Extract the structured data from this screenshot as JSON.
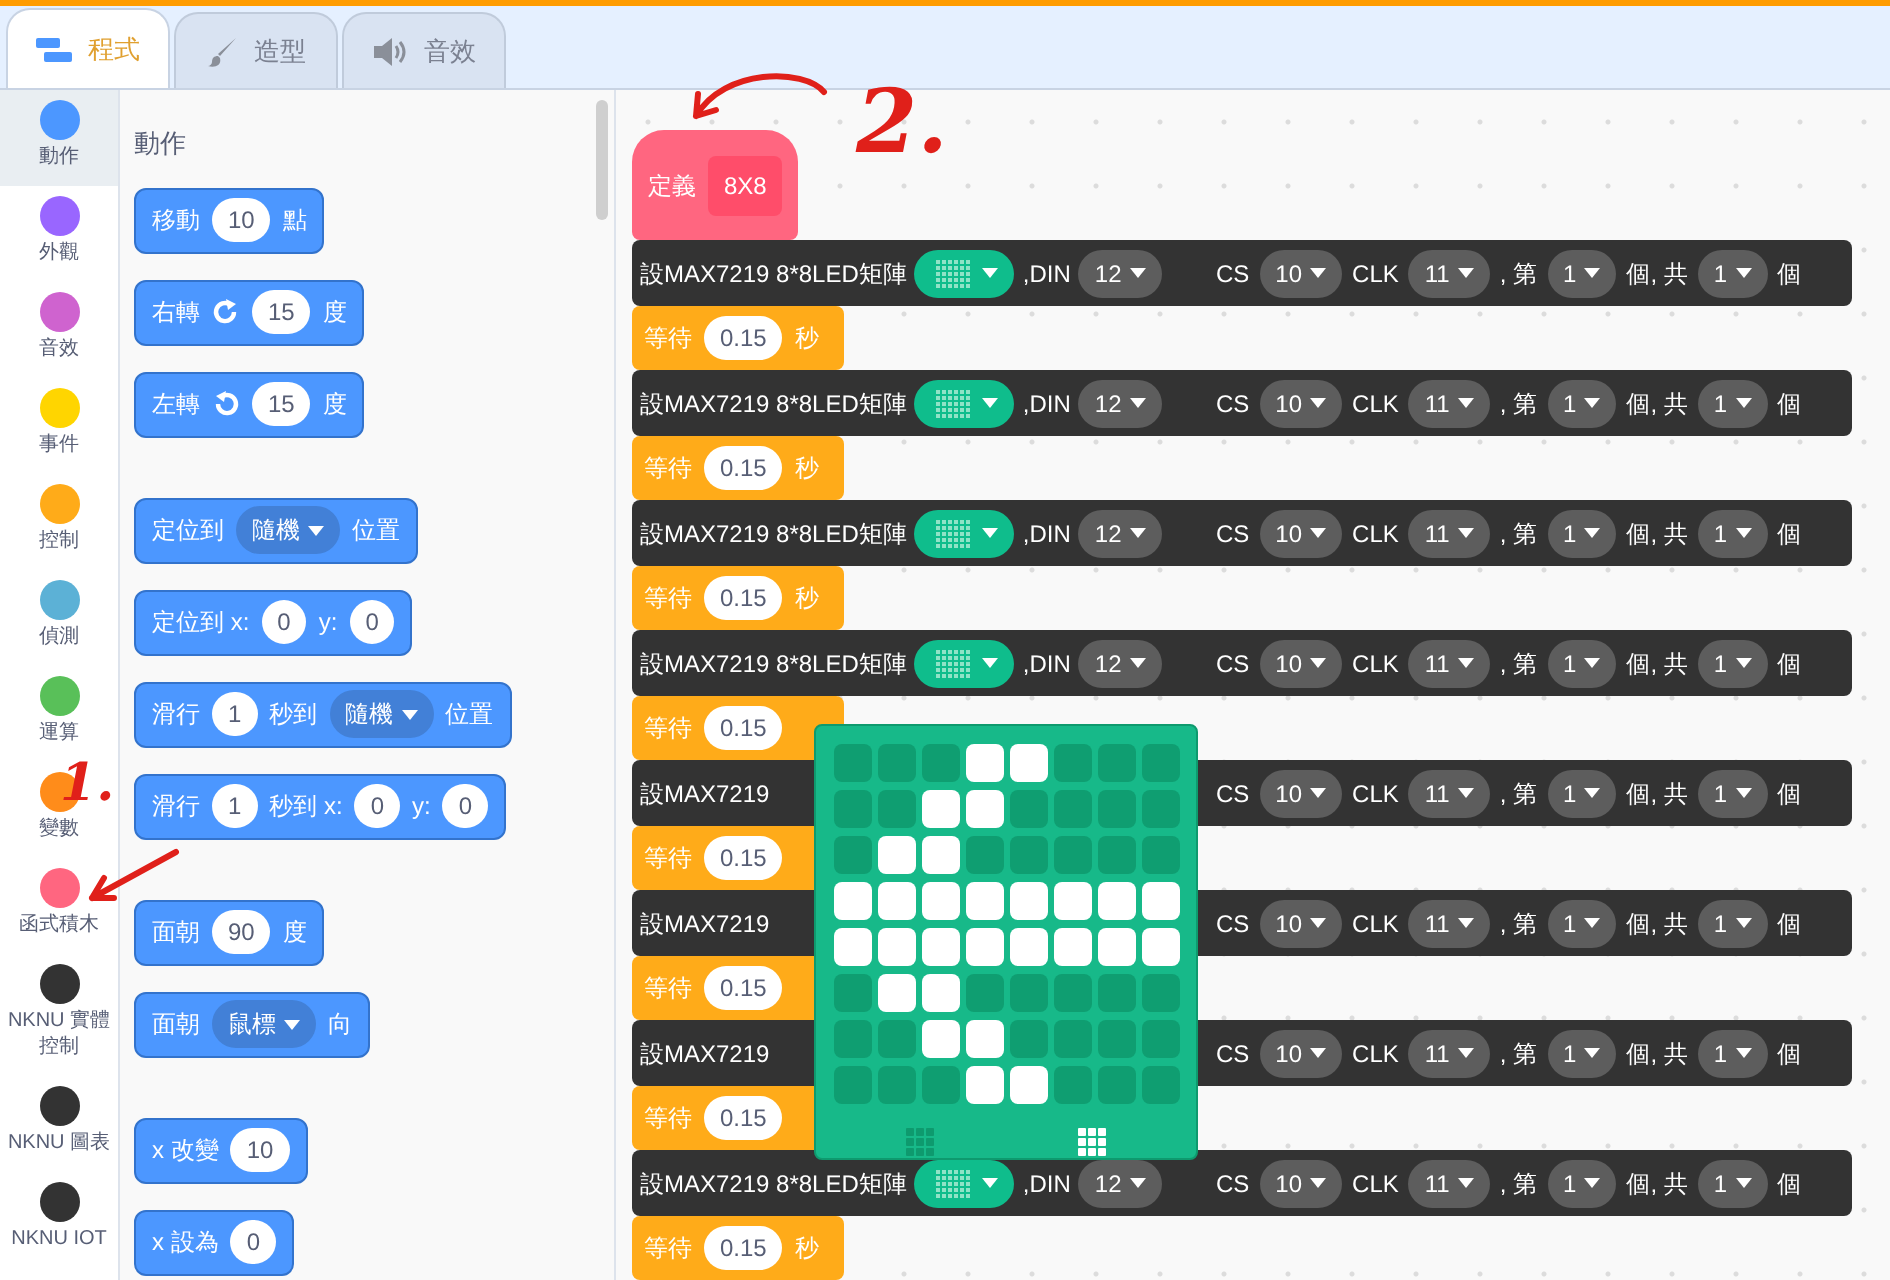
{
  "tabs": [
    {
      "label": "程式",
      "selected": true
    },
    {
      "label": "造型",
      "selected": false
    },
    {
      "label": "音效",
      "selected": false
    }
  ],
  "categories": [
    {
      "label": "動作",
      "color": "#4c97ff",
      "selected": true
    },
    {
      "label": "外觀",
      "color": "#9966ff",
      "selected": false
    },
    {
      "label": "音效",
      "color": "#cf63cf",
      "selected": false
    },
    {
      "label": "事件",
      "color": "#ffd500",
      "selected": false
    },
    {
      "label": "控制",
      "color": "#ffab19",
      "selected": false
    },
    {
      "label": "偵測",
      "color": "#5cb1d6",
      "selected": false
    },
    {
      "label": "運算",
      "color": "#59c059",
      "selected": false
    },
    {
      "label": "變數",
      "color": "#ff8c1a",
      "selected": false
    },
    {
      "label": "函式積木",
      "color": "#ff6680",
      "selected": false
    },
    {
      "label": "NKNU 實體控制",
      "color": "#333333",
      "selected": false
    },
    {
      "label": "NKNU 圖表",
      "color": "#333333",
      "selected": false
    },
    {
      "label": "NKNU IOT",
      "color": "#333333",
      "selected": false
    }
  ],
  "palette": {
    "heading": "動作",
    "groups": [
      [
        {
          "parts": [
            {
              "kind": "text",
              "text": "移動"
            },
            {
              "kind": "number",
              "text": "10"
            },
            {
              "kind": "text",
              "text": "點"
            }
          ]
        },
        {
          "parts": [
            {
              "kind": "text",
              "text": "右轉"
            },
            {
              "kind": "rotate-right"
            },
            {
              "kind": "number",
              "text": "15"
            },
            {
              "kind": "text",
              "text": "度"
            }
          ]
        },
        {
          "parts": [
            {
              "kind": "text",
              "text": "左轉"
            },
            {
              "kind": "rotate-left"
            },
            {
              "kind": "number",
              "text": "15"
            },
            {
              "kind": "text",
              "text": "度"
            }
          ]
        }
      ],
      [
        {
          "parts": [
            {
              "kind": "text",
              "text": "定位到"
            },
            {
              "kind": "dropdown",
              "text": "隨機"
            },
            {
              "kind": "text",
              "text": "位置"
            }
          ]
        },
        {
          "parts": [
            {
              "kind": "text",
              "text": "定位到 x:"
            },
            {
              "kind": "number",
              "text": "0"
            },
            {
              "kind": "text",
              "text": "y:"
            },
            {
              "kind": "number",
              "text": "0"
            }
          ]
        },
        {
          "parts": [
            {
              "kind": "text",
              "text": "滑行"
            },
            {
              "kind": "number",
              "text": "1"
            },
            {
              "kind": "text",
              "text": "秒到"
            },
            {
              "kind": "dropdown",
              "text": "隨機"
            },
            {
              "kind": "text",
              "text": "位置"
            }
          ]
        },
        {
          "parts": [
            {
              "kind": "text",
              "text": "滑行"
            },
            {
              "kind": "number",
              "text": "1"
            },
            {
              "kind": "text",
              "text": "秒到 x:"
            },
            {
              "kind": "number",
              "text": "0"
            },
            {
              "kind": "text",
              "text": "y:"
            },
            {
              "kind": "number",
              "text": "0"
            }
          ]
        }
      ],
      [
        {
          "parts": [
            {
              "kind": "text",
              "text": "面朝"
            },
            {
              "kind": "number",
              "text": "90"
            },
            {
              "kind": "text",
              "text": "度"
            }
          ]
        },
        {
          "parts": [
            {
              "kind": "text",
              "text": "面朝"
            },
            {
              "kind": "dropdown",
              "text": "鼠標"
            },
            {
              "kind": "text",
              "text": "向"
            }
          ]
        }
      ],
      [
        {
          "parts": [
            {
              "kind": "text",
              "text": "x 改變"
            },
            {
              "kind": "number",
              "text": "10"
            }
          ]
        },
        {
          "parts": [
            {
              "kind": "text",
              "text": "x 設為"
            },
            {
              "kind": "number",
              "text": "0"
            }
          ]
        }
      ]
    ]
  },
  "workspace": {
    "hat": {
      "label": "定義",
      "name": "8X8"
    },
    "blocks": [
      {
        "kind": "led",
        "head": [
          {
            "kind": "text",
            "text": "設MAX7219 8*8LED矩陣"
          },
          {
            "kind": "matrix"
          },
          {
            "kind": "text",
            "text": ",DIN"
          },
          {
            "kind": "dropdown",
            "text": "12"
          }
        ],
        "tail": [
          {
            "kind": "text",
            "text": "CS"
          },
          {
            "kind": "dropdown",
            "text": "10"
          },
          {
            "kind": "text",
            "text": "CLK"
          },
          {
            "kind": "dropdown",
            "text": "11"
          },
          {
            "kind": "text",
            "text": ", 第"
          },
          {
            "kind": "dropdown",
            "text": "1"
          },
          {
            "kind": "text",
            "text": "個, 共"
          },
          {
            "kind": "dropdown",
            "text": "1"
          },
          {
            "kind": "text",
            "text": "個"
          }
        ]
      },
      {
        "kind": "wait",
        "parts": [
          {
            "kind": "text",
            "text": "等待"
          },
          {
            "kind": "number",
            "text": "0.15"
          },
          {
            "kind": "text",
            "text": "秒"
          }
        ]
      },
      {
        "kind": "led",
        "head": [
          {
            "kind": "text",
            "text": "設MAX7219 8*8LED矩陣"
          },
          {
            "kind": "matrix"
          },
          {
            "kind": "text",
            "text": ",DIN"
          },
          {
            "kind": "dropdown",
            "text": "12"
          }
        ],
        "tail": [
          {
            "kind": "text",
            "text": "CS"
          },
          {
            "kind": "dropdown",
            "text": "10"
          },
          {
            "kind": "text",
            "text": "CLK"
          },
          {
            "kind": "dropdown",
            "text": "11"
          },
          {
            "kind": "text",
            "text": ", 第"
          },
          {
            "kind": "dropdown",
            "text": "1"
          },
          {
            "kind": "text",
            "text": "個, 共"
          },
          {
            "kind": "dropdown",
            "text": "1"
          },
          {
            "kind": "text",
            "text": "個"
          }
        ]
      },
      {
        "kind": "wait",
        "parts": [
          {
            "kind": "text",
            "text": "等待"
          },
          {
            "kind": "number",
            "text": "0.15"
          },
          {
            "kind": "text",
            "text": "秒"
          }
        ]
      },
      {
        "kind": "led",
        "head": [
          {
            "kind": "text",
            "text": "設MAX7219 8*8LED矩陣"
          },
          {
            "kind": "matrix"
          },
          {
            "kind": "text",
            "text": ",DIN"
          },
          {
            "kind": "dropdown",
            "text": "12"
          }
        ],
        "tail": [
          {
            "kind": "text",
            "text": "CS"
          },
          {
            "kind": "dropdown",
            "text": "10"
          },
          {
            "kind": "text",
            "text": "CLK"
          },
          {
            "kind": "dropdown",
            "text": "11"
          },
          {
            "kind": "text",
            "text": ", 第"
          },
          {
            "kind": "dropdown",
            "text": "1"
          },
          {
            "kind": "text",
            "text": "個, 共"
          },
          {
            "kind": "dropdown",
            "text": "1"
          },
          {
            "kind": "text",
            "text": "個"
          }
        ]
      },
      {
        "kind": "wait",
        "parts": [
          {
            "kind": "text",
            "text": "等待"
          },
          {
            "kind": "number",
            "text": "0.15"
          },
          {
            "kind": "text",
            "text": "秒"
          }
        ]
      },
      {
        "kind": "led",
        "head": [
          {
            "kind": "text",
            "text": "設MAX7219 8*8LED矩陣"
          },
          {
            "kind": "matrix"
          },
          {
            "kind": "text",
            "text": ",DIN"
          },
          {
            "kind": "dropdown",
            "text": "12"
          }
        ],
        "tail": [
          {
            "kind": "text",
            "text": "CS"
          },
          {
            "kind": "dropdown",
            "text": "10"
          },
          {
            "kind": "text",
            "text": "CLK"
          },
          {
            "kind": "dropdown",
            "text": "11"
          },
          {
            "kind": "text",
            "text": ", 第"
          },
          {
            "kind": "dropdown",
            "text": "1"
          },
          {
            "kind": "text",
            "text": "個, 共"
          },
          {
            "kind": "dropdown",
            "text": "1"
          },
          {
            "kind": "text",
            "text": "個"
          }
        ]
      },
      {
        "kind": "wait",
        "parts": [
          {
            "kind": "text",
            "text": "等待"
          },
          {
            "kind": "number",
            "text": "0.15"
          }
        ]
      },
      {
        "kind": "led",
        "head": [
          {
            "kind": "text",
            "text": "設MAX7219"
          }
        ],
        "tail": [
          {
            "kind": "text",
            "text": "CS"
          },
          {
            "kind": "dropdown",
            "text": "10"
          },
          {
            "kind": "text",
            "text": "CLK"
          },
          {
            "kind": "dropdown",
            "text": "11"
          },
          {
            "kind": "text",
            "text": ", 第"
          },
          {
            "kind": "dropdown",
            "text": "1"
          },
          {
            "kind": "text",
            "text": "個, 共"
          },
          {
            "kind": "dropdown",
            "text": "1"
          },
          {
            "kind": "text",
            "text": "個"
          }
        ]
      },
      {
        "kind": "wait",
        "parts": [
          {
            "kind": "text",
            "text": "等待"
          },
          {
            "kind": "number",
            "text": "0.15"
          }
        ]
      },
      {
        "kind": "led",
        "head": [
          {
            "kind": "text",
            "text": "設MAX7219"
          }
        ],
        "tail": [
          {
            "kind": "text",
            "text": "CS"
          },
          {
            "kind": "dropdown",
            "text": "10"
          },
          {
            "kind": "text",
            "text": "CLK"
          },
          {
            "kind": "dropdown",
            "text": "11"
          },
          {
            "kind": "text",
            "text": ", 第"
          },
          {
            "kind": "dropdown",
            "text": "1"
          },
          {
            "kind": "text",
            "text": "個, 共"
          },
          {
            "kind": "dropdown",
            "text": "1"
          },
          {
            "kind": "text",
            "text": "個"
          }
        ]
      },
      {
        "kind": "wait",
        "parts": [
          {
            "kind": "text",
            "text": "等待"
          },
          {
            "kind": "number",
            "text": "0.15"
          }
        ]
      },
      {
        "kind": "led",
        "head": [
          {
            "kind": "text",
            "text": "設MAX7219"
          }
        ],
        "tail": [
          {
            "kind": "text",
            "text": "CS"
          },
          {
            "kind": "dropdown",
            "text": "10"
          },
          {
            "kind": "text",
            "text": "CLK"
          },
          {
            "kind": "dropdown",
            "text": "11"
          },
          {
            "kind": "text",
            "text": ", 第"
          },
          {
            "kind": "dropdown",
            "text": "1"
          },
          {
            "kind": "text",
            "text": "個, 共"
          },
          {
            "kind": "dropdown",
            "text": "1"
          },
          {
            "kind": "text",
            "text": "個"
          }
        ]
      },
      {
        "kind": "wait",
        "parts": [
          {
            "kind": "text",
            "text": "等待"
          },
          {
            "kind": "number",
            "text": "0.15"
          }
        ]
      },
      {
        "kind": "led",
        "head": [
          {
            "kind": "text",
            "text": "設MAX7219 8*8LED矩陣"
          },
          {
            "kind": "matrix"
          },
          {
            "kind": "text",
            "text": ",DIN"
          },
          {
            "kind": "dropdown",
            "text": "12"
          }
        ],
        "tail": [
          {
            "kind": "text",
            "text": "CS"
          },
          {
            "kind": "dropdown",
            "text": "10"
          },
          {
            "kind": "text",
            "text": "CLK"
          },
          {
            "kind": "dropdown",
            "text": "11"
          },
          {
            "kind": "text",
            "text": ", 第"
          },
          {
            "kind": "dropdown",
            "text": "1"
          },
          {
            "kind": "text",
            "text": "個, 共"
          },
          {
            "kind": "dropdown",
            "text": "1"
          },
          {
            "kind": "text",
            "text": "個"
          }
        ]
      },
      {
        "kind": "wait",
        "parts": [
          {
            "kind": "text",
            "text": "等待"
          },
          {
            "kind": "number",
            "text": "0.15"
          },
          {
            "kind": "text",
            "text": "秒"
          }
        ]
      }
    ],
    "matrix_popup": {
      "leds": [
        [
          false,
          false,
          false,
          true,
          true,
          false,
          false,
          false
        ],
        [
          false,
          false,
          true,
          true,
          false,
          false,
          false,
          false
        ],
        [
          false,
          true,
          true,
          false,
          false,
          false,
          false,
          false
        ],
        [
          true,
          true,
          true,
          true,
          true,
          true,
          true,
          true
        ],
        [
          true,
          true,
          true,
          true,
          true,
          true,
          true,
          true
        ],
        [
          false,
          true,
          true,
          false,
          false,
          false,
          false,
          false
        ],
        [
          false,
          false,
          true,
          true,
          false,
          false,
          false,
          false
        ],
        [
          false,
          false,
          false,
          true,
          true,
          false,
          false,
          false
        ]
      ]
    }
  },
  "annotations": [
    {
      "text": "1."
    },
    {
      "text": "2."
    }
  ]
}
